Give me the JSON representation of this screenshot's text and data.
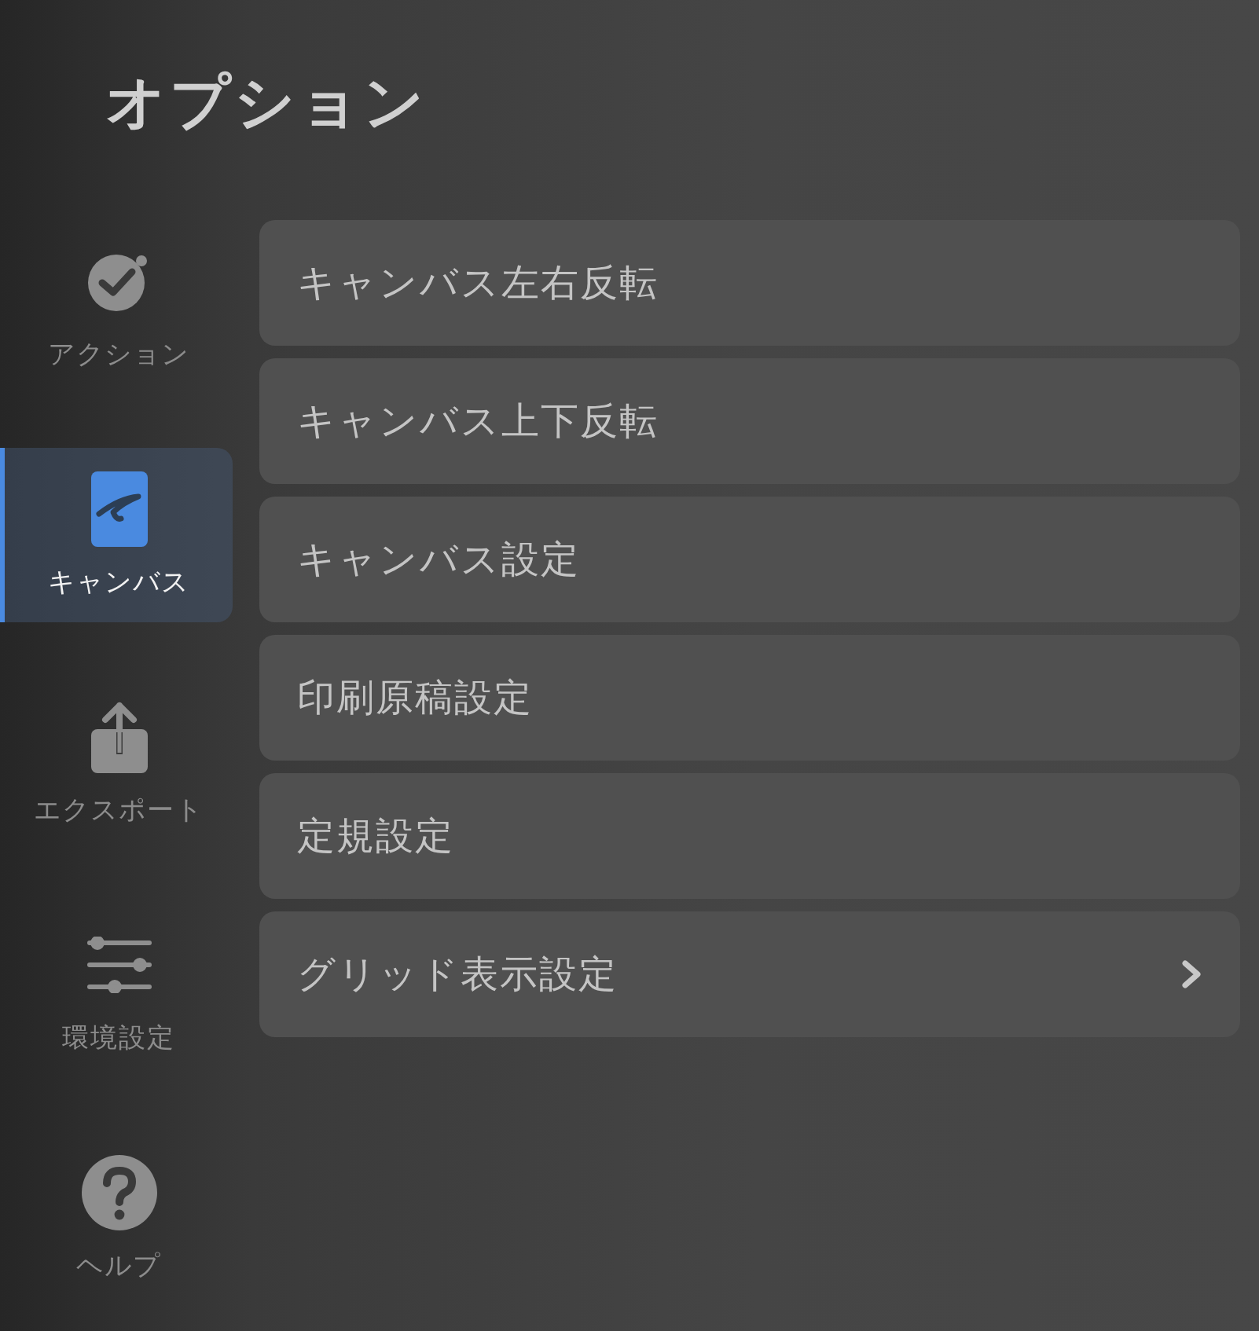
{
  "title": "オプション",
  "sidebar": {
    "items": [
      {
        "label": "アクション",
        "kind": "action",
        "selected": false
      },
      {
        "label": "キャンバス",
        "kind": "canvas",
        "selected": true
      },
      {
        "label": "エクスポート",
        "kind": "export",
        "selected": false
      },
      {
        "label": "環境設定",
        "kind": "preferences",
        "selected": false
      },
      {
        "label": "ヘルプ",
        "kind": "help",
        "selected": false
      }
    ]
  },
  "menu": [
    {
      "label": "キャンバス左右反転",
      "kind": "action"
    },
    {
      "label": "キャンバス上下反転",
      "kind": "action"
    },
    {
      "label": "キャンバス設定",
      "kind": "action"
    },
    {
      "label": "印刷原稿設定",
      "kind": "action"
    },
    {
      "label": "定規設定",
      "kind": "action"
    },
    {
      "label": "グリッド表示設定",
      "kind": "submenu"
    }
  ]
}
